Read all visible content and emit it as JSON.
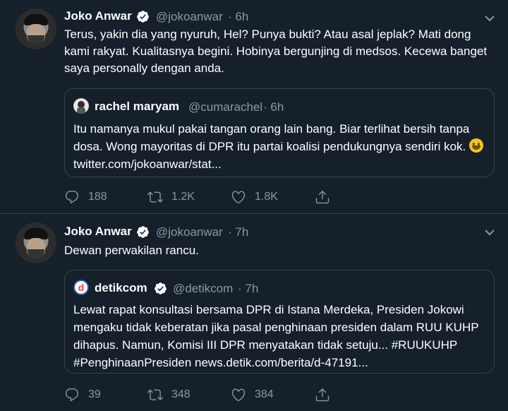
{
  "tweets": [
    {
      "author_name": "Joko Anwar",
      "author_handle": "@jokoanwar",
      "time": "· 6h",
      "text": "Terus, yakin dia yang nyuruh, Hel? Punya bukti? Atau asal jeplak? Mati dong kami rakyat. Kualitasnya begini. Hobinya bergunjing di medsos. Kecewa banget saya personally dengan anda.",
      "quote": {
        "author_name": "rachel maryam",
        "author_handle": "@cumarachel",
        "time": "· 6h",
        "text_before_emoji": "Itu namanya mukul pakai tangan orang lain bang. Biar terlihat bersih tanpa dosa. Wong mayoritas di DPR itu partai koalisi pendukungnya sendiri kok.",
        "text_after_emoji": "twitter.com/jokoanwar/stat..."
      },
      "replies": "188",
      "retweets": "1.2K",
      "likes": "1.8K"
    },
    {
      "author_name": "Joko Anwar",
      "author_handle": "@jokoanwar",
      "time": "· 7h",
      "text": "Dewan perwakilan rancu.",
      "quote": {
        "author_name": "detikcom",
        "author_handle": "@detikcom",
        "time": "· 7h",
        "text": "Lewat rapat konsultasi bersama DPR di Istana Merdeka, Presiden Jokowi mengaku tidak keberatan jika pasal penghinaan presiden dalam RUU KUHP dihapus. Namun, Komisi III DPR menyatakan tidak setuju... #RUUKUHP #PenghinaanPresiden news.detik.com/berita/d-47191..."
      },
      "replies": "39",
      "retweets": "348",
      "likes": "384"
    }
  ],
  "colors": {
    "background": "#15202b",
    "border": "#38444d",
    "muted": "#8899a6",
    "verified": "#1da1f2"
  },
  "icons": [
    "verified-badge-icon",
    "chevron-down-icon",
    "reply-icon",
    "retweet-icon",
    "like-icon",
    "share-icon"
  ]
}
